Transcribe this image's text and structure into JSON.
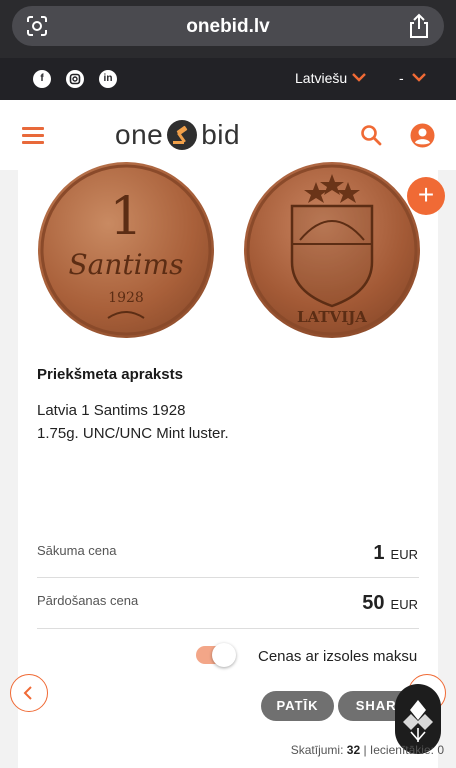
{
  "browser": {
    "url": "onebid.lv"
  },
  "top_strip": {
    "social": [
      "facebook",
      "instagram",
      "linkedin"
    ],
    "language": "Latviešu",
    "currency": "-"
  },
  "header": {
    "logo_left": "one",
    "logo_right": "bid"
  },
  "item": {
    "section_title": "Priekšmeta apraksts",
    "description_lines": [
      "Latvia 1 Santims 1928",
      "1.75g. UNC/UNC Mint luster."
    ],
    "coin_obverse_text": [
      "1",
      "Santims",
      "1928"
    ],
    "coin_reverse_text": "LATVIJA"
  },
  "prices": {
    "start_label": "Sākuma cena",
    "start_value": "1",
    "start_currency": "EUR",
    "sale_label": "Pārdošanas cena",
    "sale_value": "50",
    "sale_currency": "EUR"
  },
  "toggle": {
    "label": "Cenas ar izsoles maksu",
    "on": true
  },
  "actions": {
    "like": "PATĪK",
    "share": "SHARE"
  },
  "stats": {
    "views_label": "Skatījumi:",
    "views_value": "32",
    "likes_label": "Iecienītākie:",
    "likes_value": "0"
  },
  "colors": {
    "accent": "#f06a35",
    "dark": "#222226",
    "pill": "#707070"
  }
}
